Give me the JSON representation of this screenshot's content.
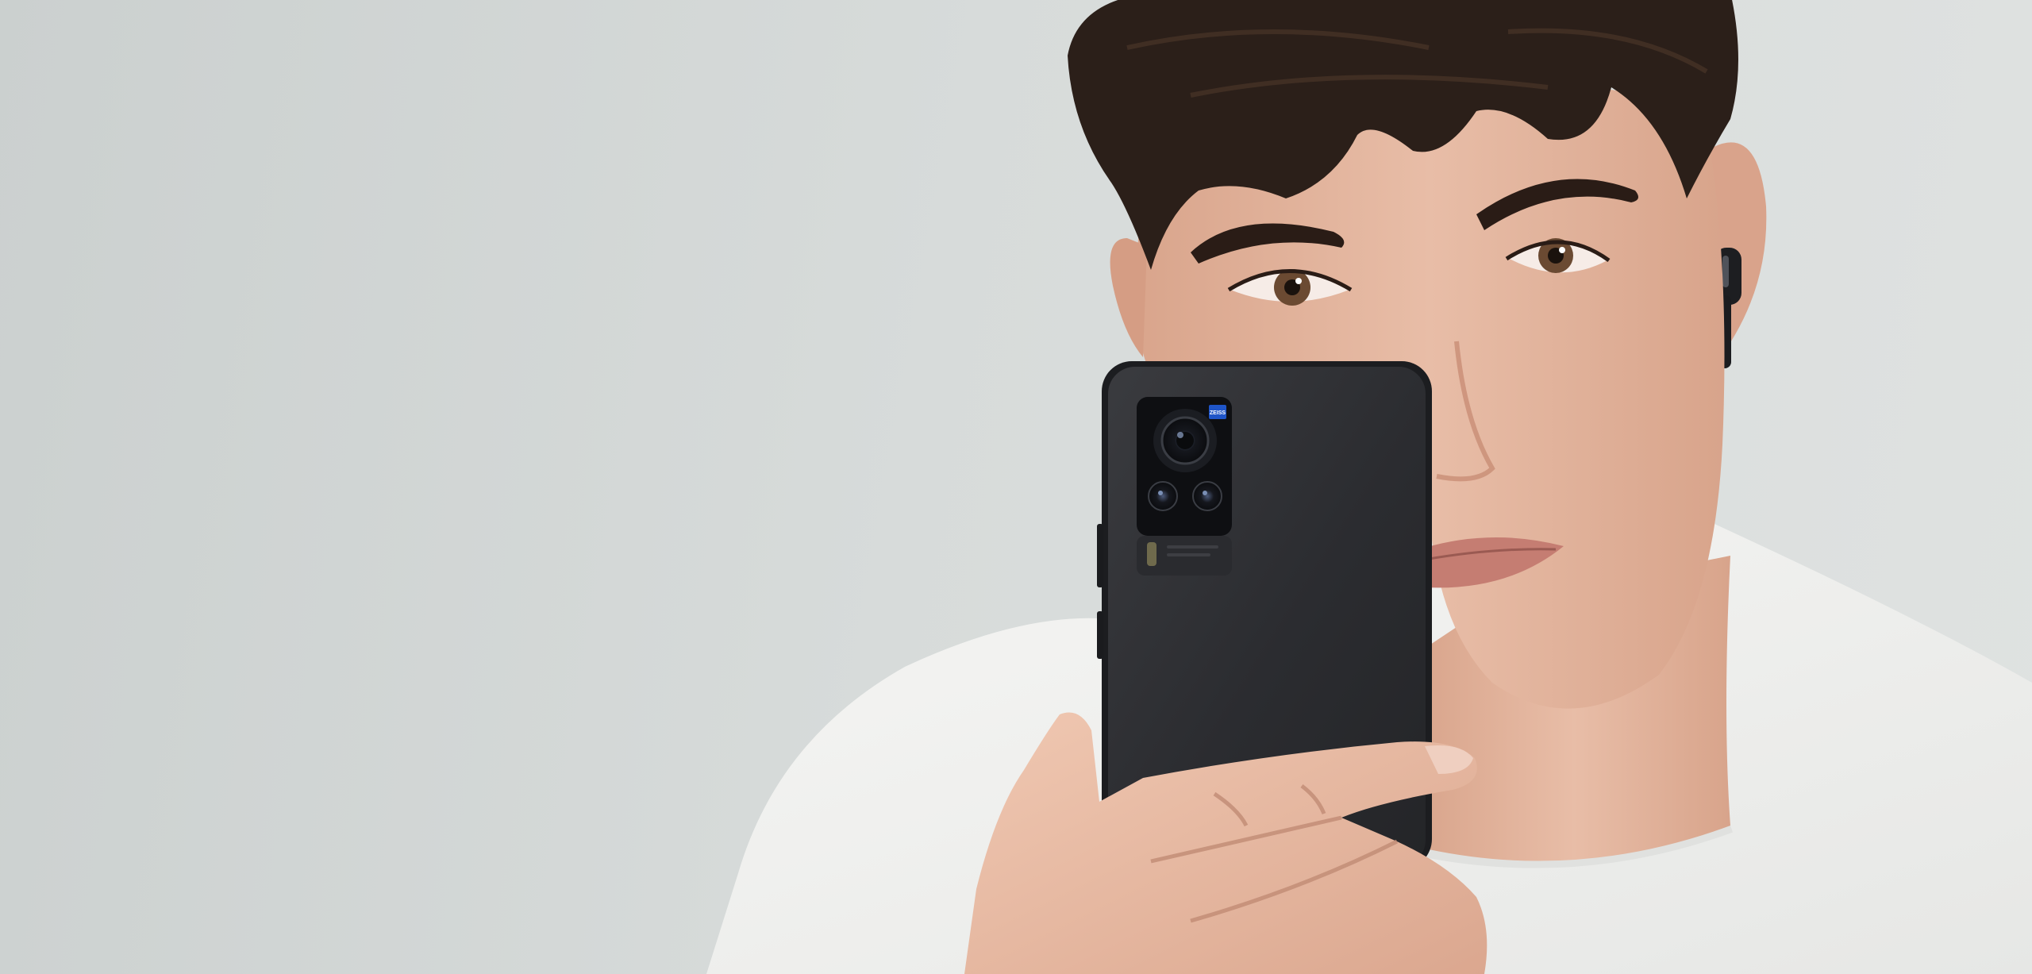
{
  "photo": {
    "subject": "",
    "colors": {
      "background": "#d6dad9",
      "shirt": "#f1f1ef",
      "skin": "#e2b59f",
      "hair": "#2a1e18",
      "phone": "#2b2c2f",
      "zeiss_badge": "#1f55c8"
    },
    "camera_badge_label": "ZEISS"
  }
}
